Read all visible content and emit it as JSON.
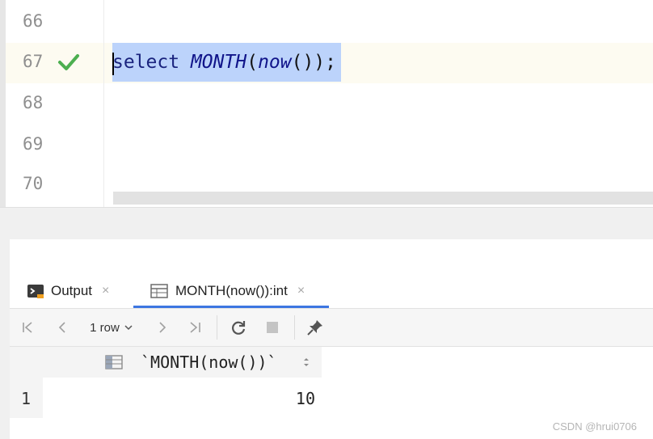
{
  "editor": {
    "line_numbers": [
      "66",
      "67",
      "68",
      "69",
      "70"
    ],
    "code": {
      "keyword": "select",
      "function": "MONTH",
      "open_paren": "(",
      "inner_function": "now",
      "rest": "());"
    },
    "status_icon": "checkmark-icon",
    "selection_color": "#bcd3fb",
    "check_color": "#4caf50"
  },
  "tabs": [
    {
      "label": "Output",
      "icon": "console-icon",
      "close": "×"
    },
    {
      "label": "MONTH(now()):int",
      "icon": "table-icon",
      "close": "×"
    }
  ],
  "toolbar": {
    "first_icon": "first-page-icon",
    "prev_icon": "prev-page-icon",
    "rows_label": "1 row",
    "rows_dropdown_icon": "chevron-down-icon",
    "next_icon": "next-page-icon",
    "last_icon": "last-page-icon",
    "refresh_icon": "refresh-icon",
    "stop_icon": "stop-icon",
    "pin_icon": "pin-icon"
  },
  "result": {
    "column_header": "`MONTH(now())`",
    "column_icon": "column-icon",
    "sort_icon": "sort-icon",
    "rows": [
      {
        "num": "1",
        "value": "10"
      }
    ]
  },
  "watermark": "CSDN @hrui0706",
  "accent_color": "#3d76e1"
}
